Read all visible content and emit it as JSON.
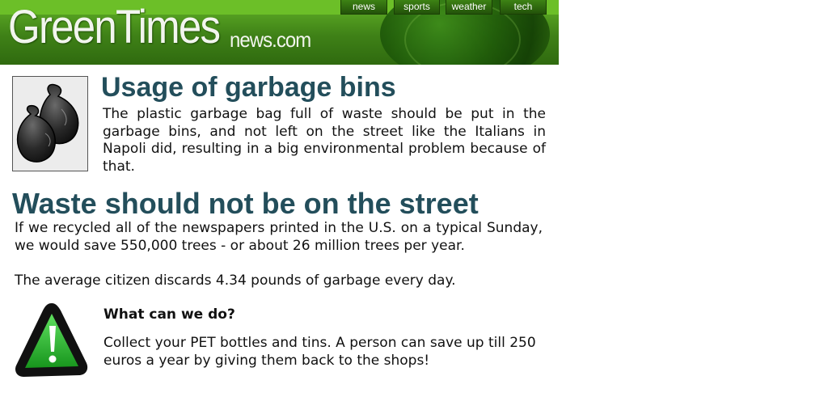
{
  "header": {
    "logo_main": "GreenTimes",
    "logo_sub": "news.com",
    "nav": [
      "news",
      "sports",
      "weather",
      "tech"
    ]
  },
  "article1": {
    "title": "Usage of garbage bins",
    "body": "The plastic garbage bag full of waste should be put in the garbage bins, and not left on the street like the Italians in Napoli did, resulting in a big environmental problem because of that.",
    "image_icon": "garbage-bags-icon"
  },
  "article2": {
    "title": "Waste should not be on the street",
    "body1": "If we recycled all of the newspapers printed in the U.S. on a typical Sunday, we would save 550,000 trees - or about 26 million trees per year.",
    "body2": "The average citizen discards 4.34 pounds of garbage every day."
  },
  "tip": {
    "icon": "warning-icon",
    "heading": "What can we do?",
    "body": "Collect your PET bottles and tins. A person can save up till 250 euros a year by giving them back to the shops!"
  },
  "colors": {
    "heading": "#234e5b",
    "header_green": "#3f8117",
    "warning_green": "#2eb82e"
  }
}
